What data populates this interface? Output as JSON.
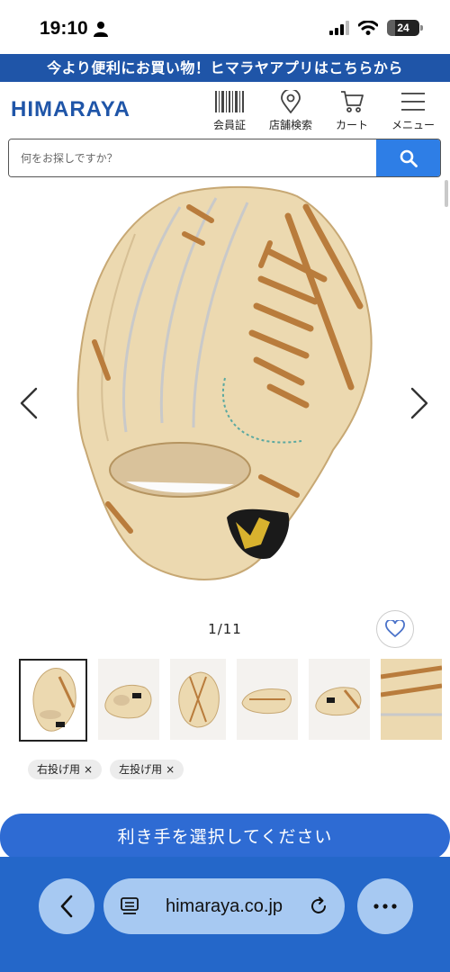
{
  "status_bar": {
    "time": "19:10",
    "battery": "24"
  },
  "app_banner": {
    "text": "今より便利にお買い物！ヒマラヤアプリはこちらから"
  },
  "header": {
    "logo": "HIMARAYA",
    "nav": [
      {
        "label": "会員証",
        "icon": "barcode-icon"
      },
      {
        "label": "店舗検索",
        "icon": "location-pin-icon"
      },
      {
        "label": "カート",
        "icon": "cart-icon"
      },
      {
        "label": "メニュー",
        "icon": "hamburger-menu-icon"
      }
    ]
  },
  "search": {
    "placeholder": "何をお探しですか？",
    "value": "",
    "icon": "search-icon"
  },
  "gallery": {
    "counter": "1/11",
    "current": 1,
    "total": 11,
    "image": "baseball-glove-photo",
    "prev_icon": "chevron-left-icon",
    "next_icon": "chevron-right-icon",
    "favorite_icon": "heart-icon"
  },
  "thumbnails": [
    {
      "name": "glove-front",
      "selected": true
    },
    {
      "name": "glove-side"
    },
    {
      "name": "glove-back"
    },
    {
      "name": "glove-lying"
    },
    {
      "name": "glove-top"
    },
    {
      "name": "glove-closeup"
    }
  ],
  "tags": [
    "右投げ用",
    "左投げ用"
  ],
  "tag_remove_symbol": "×",
  "cta": {
    "label": "利き手を選択してください"
  },
  "browser": {
    "url": "himaraya.co.jp",
    "back_icon": "chevron-left-icon",
    "reader_icon": "reader-icon",
    "reload_icon": "reload-icon",
    "more_icon": "ellipsis-icon"
  },
  "colors": {
    "brand_blue": "#1f55a8",
    "search_button": "#2e7ee6",
    "cta": "#2e6bd3",
    "toolbar": "#2467c9",
    "glove_leather": "#e9d5aa",
    "glove_lace": "#c48a45"
  }
}
